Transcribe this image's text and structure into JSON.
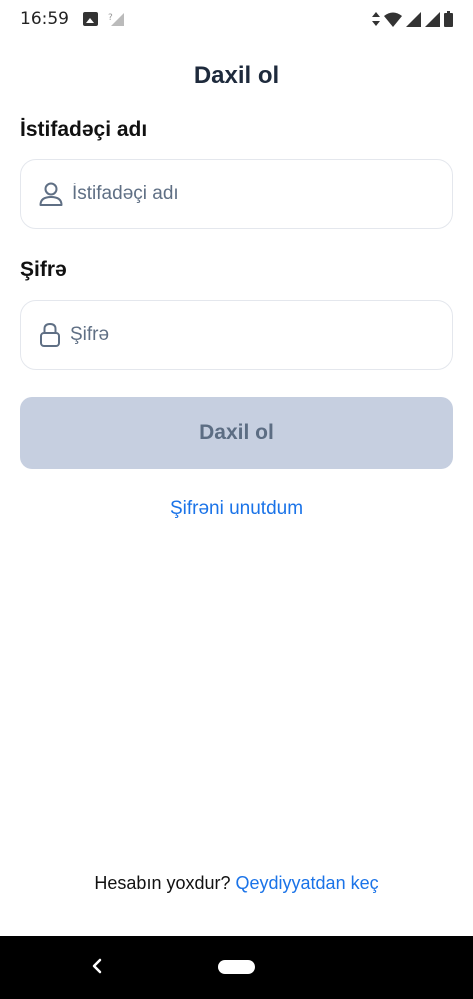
{
  "status_bar": {
    "time": "16:59"
  },
  "page": {
    "title": "Daxil ol"
  },
  "form": {
    "username_label": "İstifadəçi adı",
    "username_placeholder": "İstifadəçi adı",
    "username_value": "",
    "password_label": "Şifrə",
    "password_placeholder": "Şifrə",
    "password_value": "",
    "submit_label": "Daxil ol",
    "forgot_label": "Şifrəni unutdum"
  },
  "footer": {
    "prompt": "Hesabın yoxdur?",
    "signup_label": "Qeydiyyatdan keç"
  },
  "colors": {
    "accent": "#1a73e8",
    "button_disabled_bg": "#c6cfe0",
    "button_disabled_text": "#5c6d83",
    "title": "#1e2a3c"
  },
  "icons": {
    "username": "user-icon",
    "password": "lock-icon",
    "back": "back-chevron-icon"
  }
}
